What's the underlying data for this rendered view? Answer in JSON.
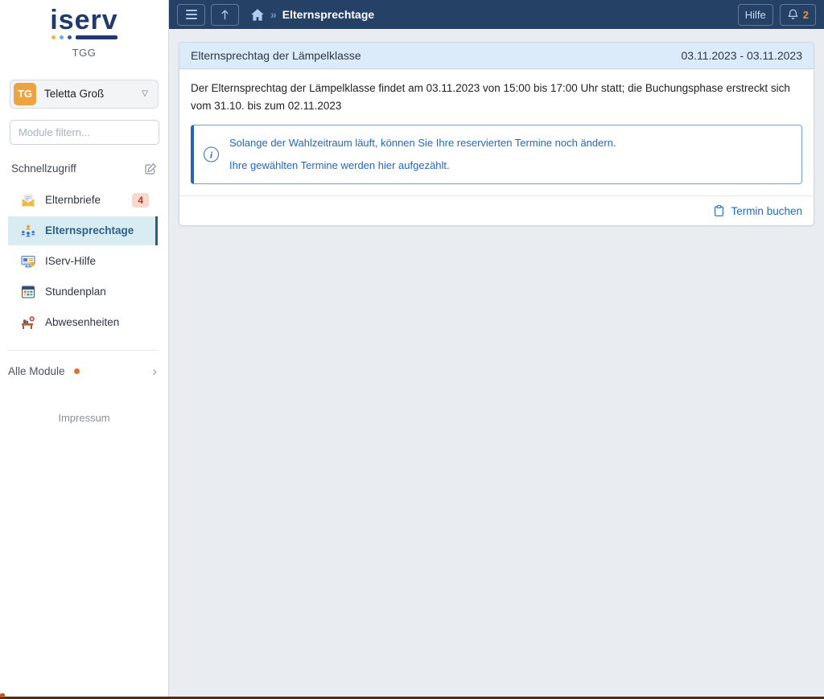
{
  "brand": {
    "logo_text": "iserv",
    "site_name": "TGG"
  },
  "navbar": {
    "breadcrumb_current": "Elternsprechtage",
    "breadcrumb_separator": "»",
    "help_label": "Hilfe",
    "notification_count": "2"
  },
  "sidebar": {
    "user": {
      "initials": "TG",
      "name": "Teletta Groß"
    },
    "filter_placeholder": "Module filtern...",
    "quick_access_label": "Schnellzugriff",
    "items": [
      {
        "label": "Elternbriefe",
        "badge": "4",
        "icon": "envelope-letter-icon"
      },
      {
        "label": "Elternsprechtage",
        "icon": "meeting-people-icon",
        "active": true
      },
      {
        "label": "IServ-Hilfe",
        "icon": "help-card-icon"
      },
      {
        "label": "Stundenplan",
        "icon": "timetable-calendar-icon"
      },
      {
        "label": "Abwesenheiten",
        "icon": "absence-desk-icon"
      }
    ],
    "all_modules_label": "Alle Module",
    "impressum_label": "Impressum"
  },
  "main": {
    "panel_title": "Elternsprechtag der Lämpelklasse",
    "panel_date_range": "03.11.2023 - 03.11.2023",
    "description": "Der Elternsprechtag der Lämpelklasse findet am 03.11.2023 von 15:00 bis 17:00 Uhr statt; die Buchungsphase erstreckt sich vom 31.10. bis zum 02.11.2023",
    "alert": {
      "line1": "Solange der Wahlzeitraum läuft, können Sie Ihre reservierten Termine noch ändern.",
      "line2": "Ihre gewählten Termine werden hier aufgezählt."
    },
    "book_appointment_label": "Termin buchen"
  },
  "colors": {
    "navbar_bg": "#264166",
    "accent_blue": "#2268c6",
    "panel_header_bg": "#dcebf9",
    "active_item_bg": "#d8ecf2",
    "active_item_text": "#2e618c",
    "active_item_bar": "#2a5f82",
    "avatar_bg": "#eea33e",
    "badge_bg": "#f7d9cd",
    "badge_text": "#b5382e",
    "notification_count_color": "#e8933f",
    "alert_border": "#2a62b8",
    "orange_dot": "#e0703a",
    "logo_navy": "#1e3a6e"
  }
}
